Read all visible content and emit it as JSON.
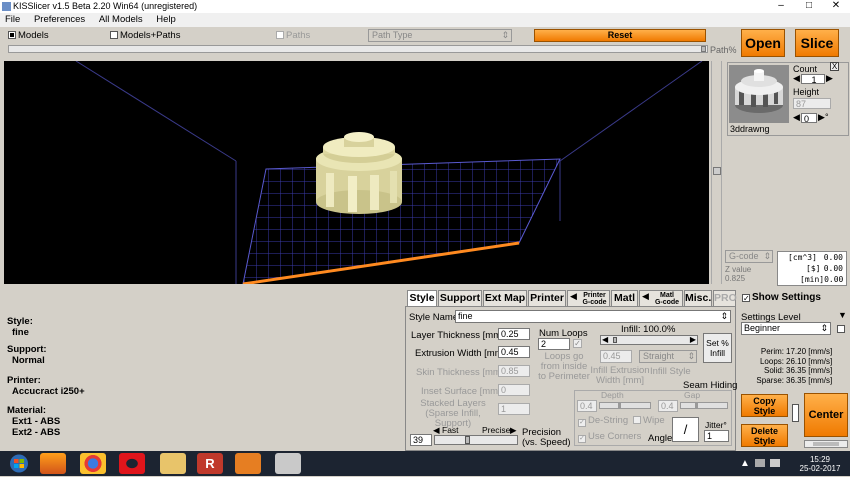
{
  "window": {
    "title": "KISSlicer v1.5 Beta 2.20 Win64 (unregistered)"
  },
  "menu": [
    "File",
    "Preferences",
    "All Models",
    "Help"
  ],
  "toolbar": {
    "models": "Models",
    "models_paths": "Models+Paths",
    "paths": "Paths",
    "path_type": "Path Type",
    "reset": "Reset",
    "path_pct": "Path%",
    "open": "Open",
    "slice": "Slice"
  },
  "model_panel": {
    "count_label": "Count",
    "count_value": "1",
    "height_label": "Height",
    "height_value": "87",
    "rotation_value": "0",
    "rotation_unit": "°",
    "model_name": "3ddrawng",
    "close": "X"
  },
  "gcode_select": "G-code",
  "z_value_label": "Z value",
  "z_value": "0.825",
  "stats": [
    {
      "unit": "[cm^3]",
      "value": "0.00"
    },
    {
      "unit": "[$]",
      "value": "0.00"
    },
    {
      "unit": "[min]",
      "value": "0.00"
    }
  ],
  "show_settings": "Show Settings",
  "settings_level": {
    "label": "Settings Level",
    "value": "Beginner"
  },
  "speeds": [
    {
      "label": "Perim:",
      "value": "17.20 [mm/s]"
    },
    {
      "label": "Loops:",
      "value": "26.10 [mm/s]"
    },
    {
      "label": "Solid:",
      "value": "36.35 [mm/s]"
    },
    {
      "label": "Sparse:",
      "value": "36.35 [mm/s]"
    }
  ],
  "actions": {
    "copy_style": "Copy Style",
    "delete_style": "Delete Style",
    "center": "Center"
  },
  "summary": {
    "style_label": "Style:",
    "style_value": "fine",
    "support_label": "Support:",
    "support_value": "Normal",
    "printer_label": "Printer:",
    "printer_value": "Accucract i250+",
    "material_label": "Material:",
    "material_1": "Ext1 - ABS",
    "material_2": "Ext2 - ABS"
  },
  "tabs": {
    "style": "Style",
    "support": "Support",
    "ext_map": "Ext Map",
    "printer": "Printer",
    "printer_gcode_1": "Printer",
    "printer_gcode_2": "G-code",
    "matl": "Matl",
    "matl_gcode_1": "Matl",
    "matl_gcode_2": "G-code",
    "misc": "Misc.",
    "pro": "PRO"
  },
  "style_tab": {
    "style_name_label": "Style Name",
    "style_name_value": "fine",
    "layer_thickness_label": "Layer Thickness [mm]",
    "layer_thickness_value": "0.25",
    "extrusion_width_label": "Extrusion Width [mm]",
    "extrusion_width_value": "0.45",
    "skin_thickness_label": "Skin Thickness [mm]",
    "skin_thickness_value": "0.85",
    "inset_surface_label": "Inset  Surface [mm]",
    "inset_surface_value": "0",
    "stacked_layers_label_1": "Stacked Layers",
    "stacked_layers_label_2": "(Sparse Infill, Support)",
    "stacked_layers_value": "1",
    "num_loops_label": "Num Loops",
    "num_loops_value": "2",
    "loops_go_1": "Loops go",
    "loops_go_2": "from inside",
    "loops_go_3": "to Perimeter",
    "infill_label": "Infill: 100.0%",
    "set_infill_1": "Set %",
    "set_infill_2": "Infill",
    "infill_extrusion_value": "0.45",
    "infill_extrusion_label_1": "Infill Extrusion",
    "infill_extrusion_label_2": "Width [mm]",
    "infill_style_value": "Straight",
    "infill_style_label": "Infill Style",
    "seam_hiding": "Seam Hiding",
    "depth_label": "Depth",
    "depth_value": "0.4",
    "gap_label": "Gap",
    "gap_value": "0.4",
    "destring": "De-String",
    "wipe": "Wipe",
    "use_corners": "Use Corners",
    "angle": "Angle",
    "angle_glyph": "/",
    "jitter_label": "Jitter°",
    "jitter_value": "1",
    "fast": "Fast",
    "precise": "Precise",
    "precision_value": "39",
    "precision_label_1": "Precision",
    "precision_label_2": "(vs. Speed)"
  },
  "taskbar": {
    "time": "15:29",
    "date": "25-02-2017"
  }
}
